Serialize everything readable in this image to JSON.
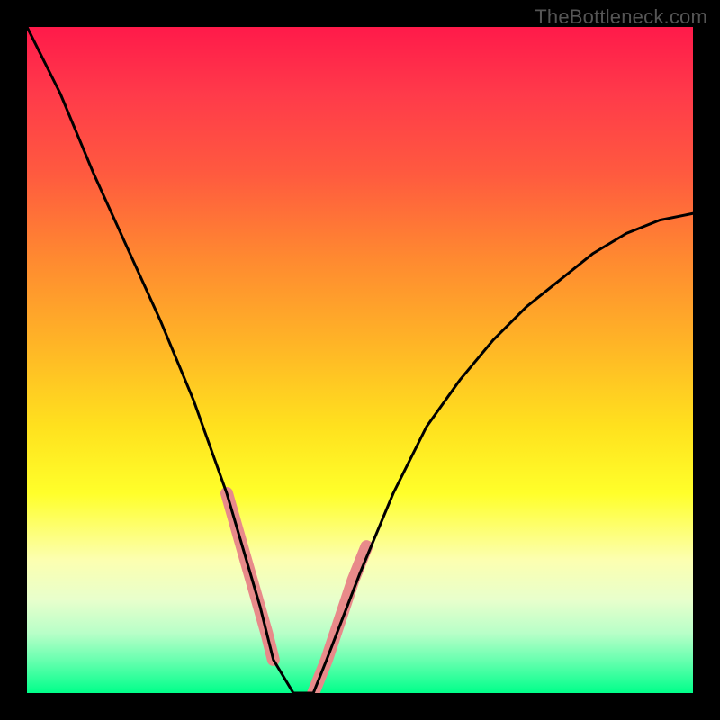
{
  "watermark": "TheBottleneck.com",
  "chart_data": {
    "type": "line",
    "title": "",
    "xlabel": "",
    "ylabel": "",
    "xlim": [
      0,
      100
    ],
    "ylim": [
      0,
      100
    ],
    "legend": false,
    "grid": false,
    "background_gradient": {
      "direction": "vertical",
      "stops": [
        {
          "pos": 0.0,
          "color": "#ff1a4a"
        },
        {
          "pos": 0.35,
          "color": "#ff8a30"
        },
        {
          "pos": 0.7,
          "color": "#ffff2a"
        },
        {
          "pos": 1.0,
          "color": "#00ff8a"
        }
      ]
    },
    "series": [
      {
        "name": "bottleneck-curve",
        "x": [
          0,
          5,
          10,
          15,
          20,
          25,
          30,
          35,
          37,
          40,
          43,
          45,
          50,
          55,
          60,
          65,
          70,
          75,
          80,
          85,
          90,
          95,
          100
        ],
        "values": [
          100,
          90,
          78,
          67,
          56,
          44,
          30,
          13,
          5,
          0,
          0,
          5,
          18,
          30,
          40,
          47,
          53,
          58,
          62,
          66,
          69,
          71,
          72
        ]
      }
    ],
    "highlight_segments": [
      {
        "name": "left-marker",
        "x": [
          30,
          32,
          34,
          36,
          37
        ],
        "values": [
          30,
          23,
          16,
          9,
          5
        ]
      },
      {
        "name": "right-marker",
        "x": [
          43,
          45,
          47,
          49,
          51
        ],
        "values": [
          0,
          5,
          11,
          17,
          22
        ]
      }
    ],
    "highlight_style": {
      "color": "#e88a8a",
      "width": 14
    },
    "curve_style": {
      "color": "#000000",
      "width": 3
    }
  }
}
